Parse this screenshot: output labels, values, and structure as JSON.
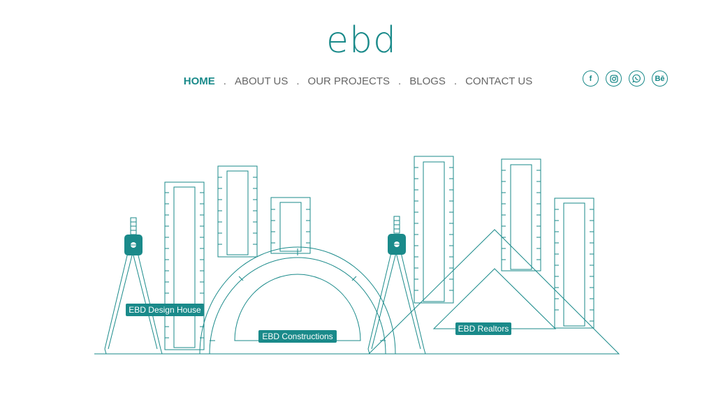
{
  "brand": {
    "logo_text": "ebd"
  },
  "nav": {
    "items": [
      {
        "label": "HOME",
        "active": true
      },
      {
        "label": "ABOUT US"
      },
      {
        "label": "OUR PROJECTS"
      },
      {
        "label": "BLOGS"
      },
      {
        "label": "CONTACT US"
      }
    ],
    "separator": "."
  },
  "social": [
    {
      "icon": "facebook-icon",
      "glyph": "f"
    },
    {
      "icon": "instagram-icon",
      "glyph": ""
    },
    {
      "icon": "whatsapp-icon",
      "glyph": ""
    },
    {
      "icon": "behance-icon",
      "glyph": "Bē"
    }
  ],
  "hotspots": {
    "design_house": "EBD Design House",
    "constructions": "EBD Constructions",
    "realtors": "EBD Realtors"
  },
  "colors": {
    "accent": "#1a8a8a",
    "nav_text": "#666666"
  }
}
